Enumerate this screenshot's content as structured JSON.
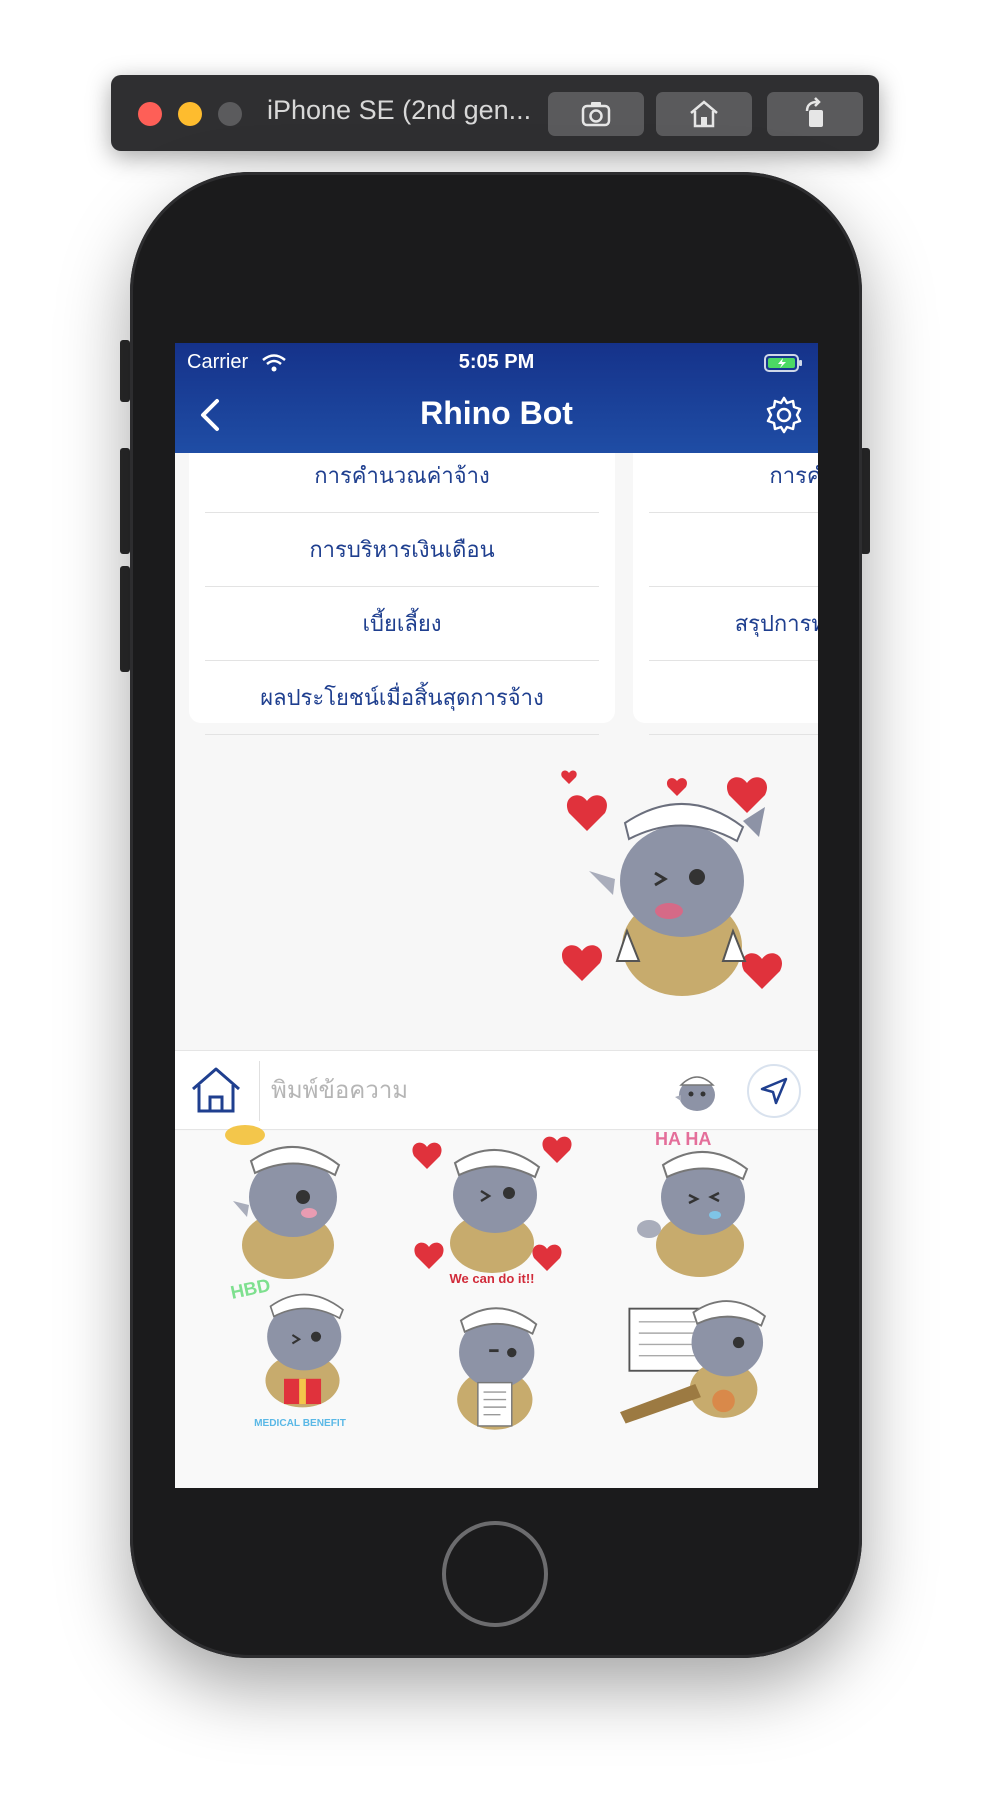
{
  "simulator": {
    "title": "iPhone SE (2nd gen...",
    "buttons": [
      "screenshot-icon",
      "home-icon",
      "rotate-icon"
    ]
  },
  "status_bar": {
    "carrier": "Carrier",
    "time": "5:05 PM"
  },
  "nav": {
    "title": "Rhino Bot",
    "back_icon": "chevron-left-icon",
    "settings_icon": "gear-icon"
  },
  "menu": {
    "card1": [
      "การคำนวณค่าจ้าง",
      "การบริหารเงินเดือน",
      "เบี้ยเลี้ยง",
      "ผลประโยชน์เมื่อสิ้นสุดการจ้าง"
    ],
    "card2": [
      "การคำน",
      "",
      "สรุปการทำง",
      ""
    ]
  },
  "chat": {
    "sticker_text": ""
  },
  "input": {
    "placeholder": "พิมพ์ข้อความ"
  },
  "stickers": [
    {
      "caption": ""
    },
    {
      "caption": "We can do it!!"
    },
    {
      "caption": "HA HA"
    },
    {
      "caption": "HBD"
    },
    {
      "caption": ""
    },
    {
      "caption": ""
    }
  ],
  "sticker_captions_extra": {
    "medical": "MEDICAL BENEFIT"
  },
  "colors": {
    "nav_top": "#15328a",
    "nav_bottom": "#1f4da5",
    "menu_text": "#1f3f8f",
    "heart": "#e0323c",
    "rhino": "#8d93a6"
  }
}
